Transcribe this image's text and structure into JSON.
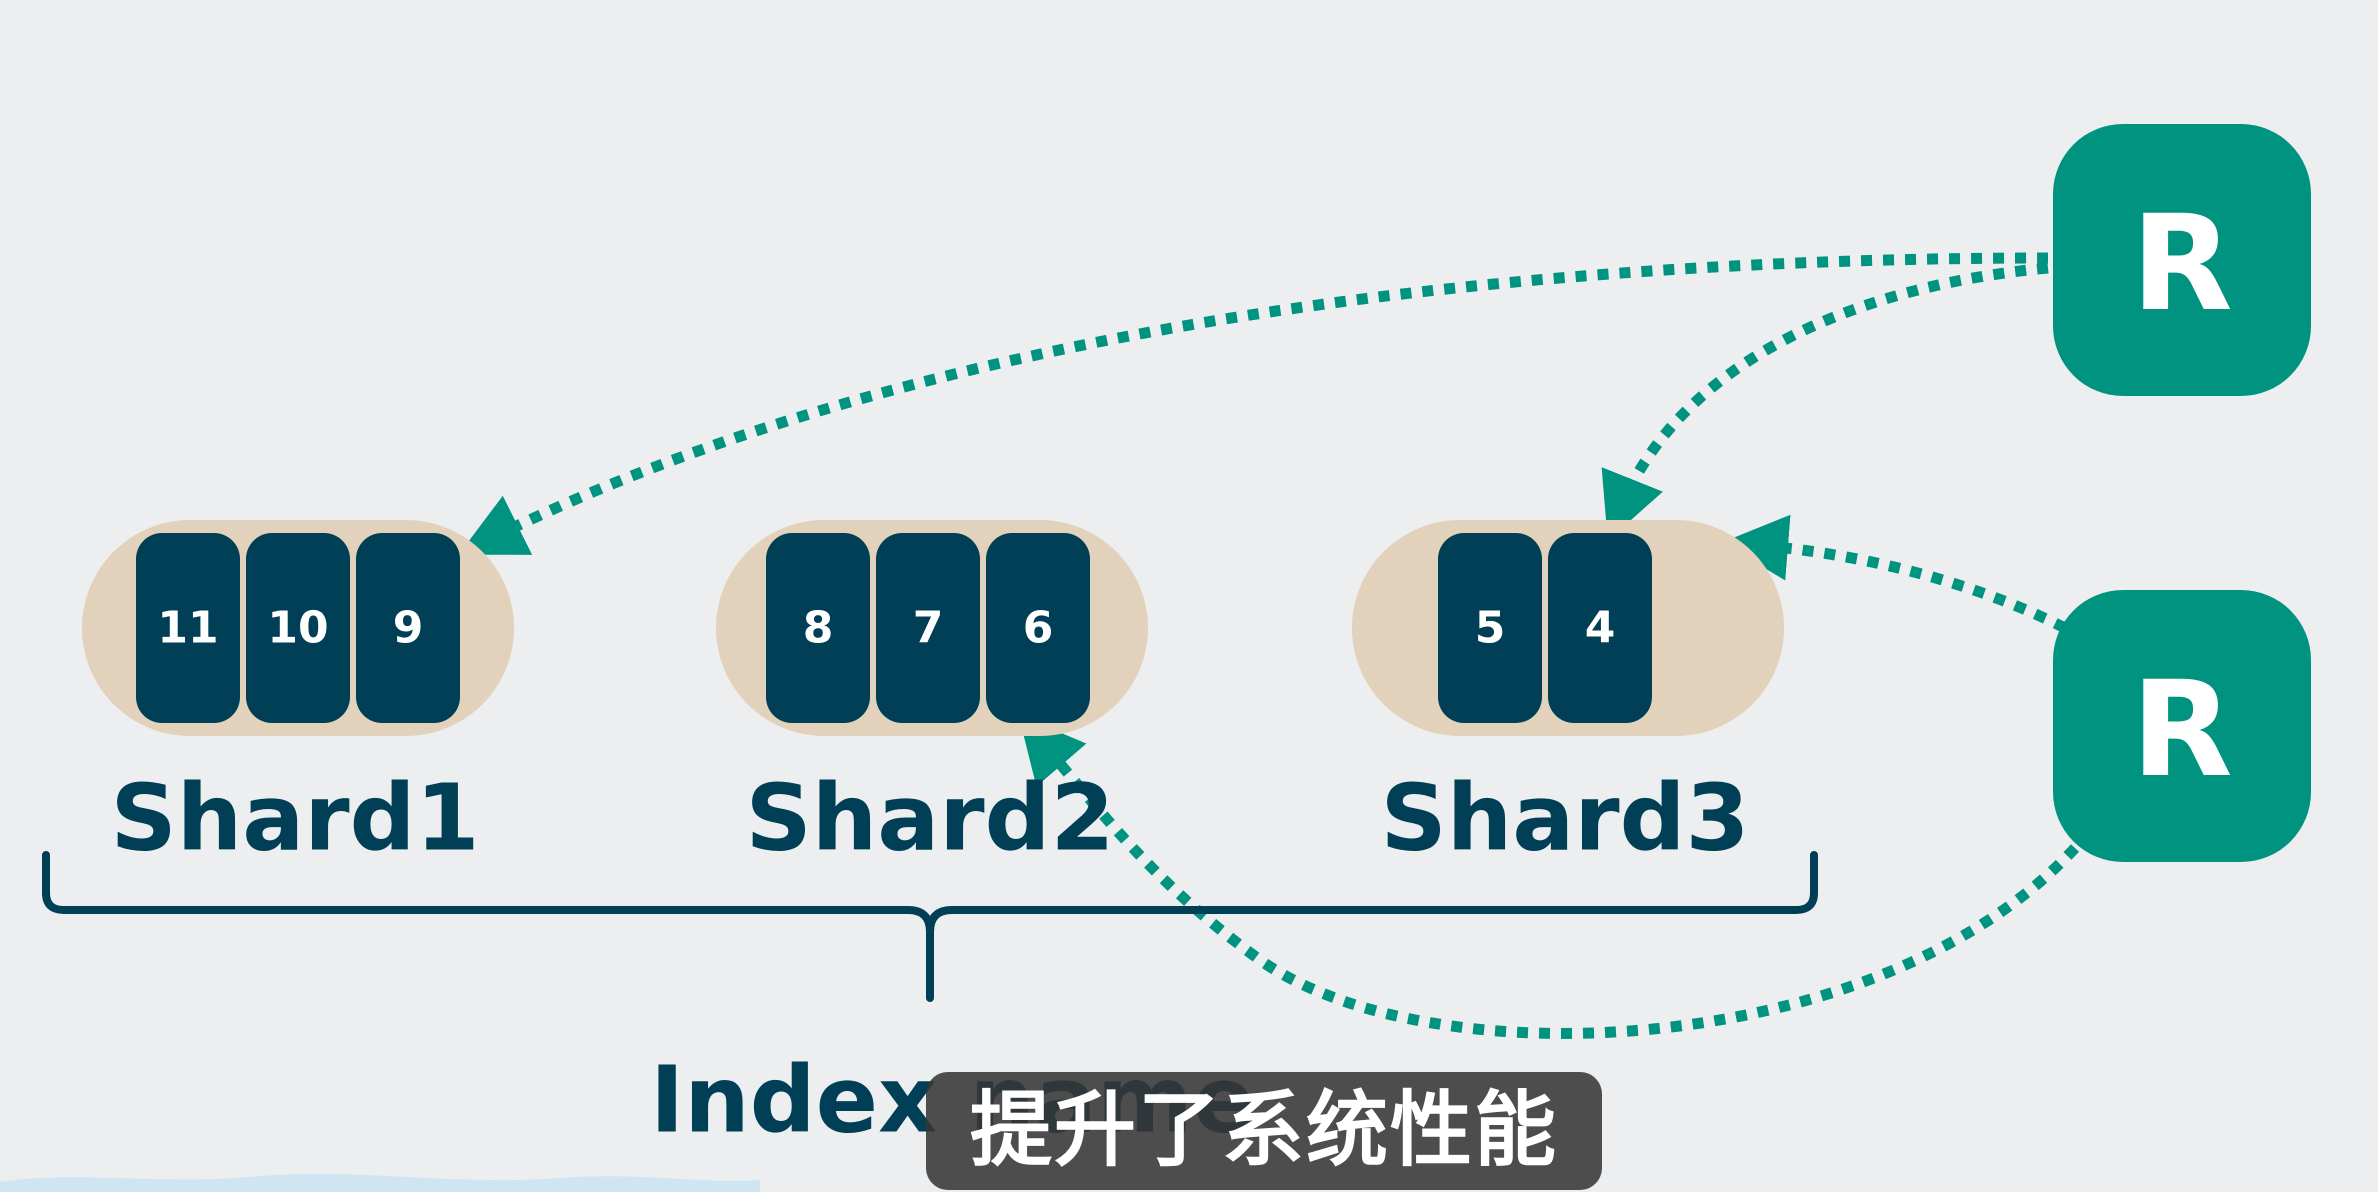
{
  "colors": {
    "background": "#eceef0",
    "teal": "#009480",
    "navy": "#003f55",
    "shard_pill": "#e2d2bb",
    "white": "#ffffff"
  },
  "replicas": [
    {
      "label": "R"
    },
    {
      "label": "R"
    }
  ],
  "shards": [
    {
      "name": "Shard1",
      "docs": [
        "11",
        "10",
        "9"
      ]
    },
    {
      "name": "Shard2",
      "docs": [
        "8",
        "7",
        "6"
      ]
    },
    {
      "name": "Shard3",
      "docs": [
        "5",
        "4"
      ]
    }
  ],
  "index_label": "Index name",
  "caption": "提升了系统性能"
}
